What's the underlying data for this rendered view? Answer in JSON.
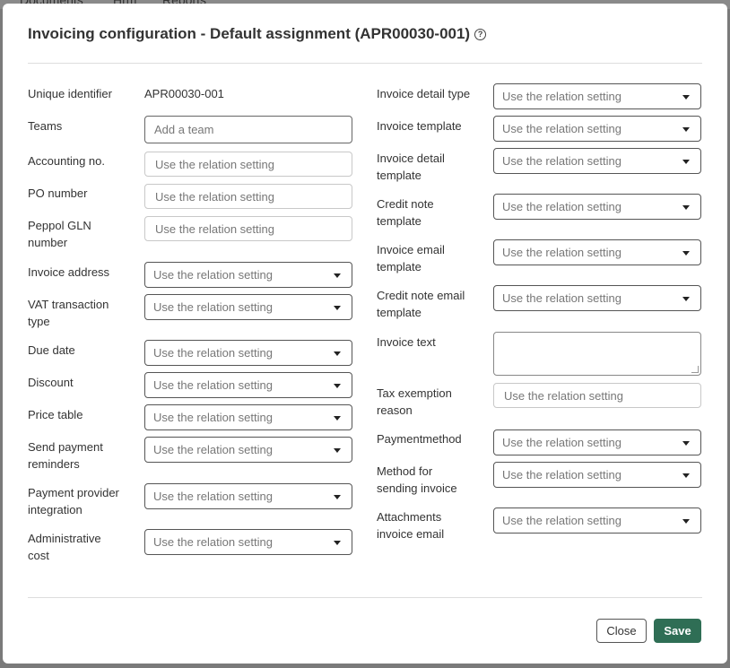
{
  "background_nav": [
    "Documents",
    "Hrm",
    "Reports"
  ],
  "dialog": {
    "title": "Invoicing configuration - Default assignment (APR00030-001)",
    "help_icon": "question-circle-icon"
  },
  "left": {
    "unique_identifier": {
      "label": "Unique identifier",
      "value": "APR00030-001"
    },
    "teams": {
      "label": "Teams",
      "placeholder": "Add a team"
    },
    "accounting_no": {
      "label": "Accounting no.",
      "placeholder": "Use the relation setting"
    },
    "po_number": {
      "label": "PO number",
      "placeholder": "Use the relation setting"
    },
    "peppol_gln": {
      "label_1": "Peppol GLN",
      "label_2": "number",
      "placeholder": "Use the relation setting"
    },
    "invoice_address": {
      "label": "Invoice address",
      "value": "Use the relation setting"
    },
    "vat_transaction_type": {
      "label_1": "VAT transaction",
      "label_2": "type",
      "value": "Use the relation setting"
    },
    "due_date": {
      "label": "Due date",
      "value": "Use the relation setting"
    },
    "discount": {
      "label": "Discount",
      "value": "Use the relation setting"
    },
    "price_table": {
      "label": "Price table",
      "value": "Use the relation setting"
    },
    "send_payment_reminders": {
      "label_1": "Send payment",
      "label_2": "reminders",
      "value": "Use the relation setting"
    },
    "payment_provider_integration": {
      "label_1": "Payment provider",
      "label_2": "integration",
      "value": "Use the relation setting"
    },
    "administrative_cost": {
      "label_1": "Administrative",
      "label_2": "cost",
      "value": "Use the relation setting"
    }
  },
  "right": {
    "invoice_detail_type": {
      "label": "Invoice detail type",
      "value": "Use the relation setting"
    },
    "invoice_template": {
      "label": "Invoice template",
      "value": "Use the relation setting"
    },
    "invoice_detail_template": {
      "label_1": "Invoice detail",
      "label_2": "template",
      "value": "Use the relation setting"
    },
    "credit_note_template": {
      "label_1": "Credit note",
      "label_2": "template",
      "value": "Use the relation setting"
    },
    "invoice_email_template": {
      "label_1": "Invoice email",
      "label_2": "template",
      "value": "Use the relation setting"
    },
    "credit_note_email_template": {
      "label_1": "Credit note email",
      "label_2": "template",
      "value": "Use the relation setting"
    },
    "invoice_text": {
      "label": "Invoice text",
      "value": ""
    },
    "tax_exemption_reason": {
      "label_1": "Tax exemption",
      "label_2": "reason",
      "placeholder": "Use the relation setting"
    },
    "paymentmethod": {
      "label": "Paymentmethod",
      "value": "Use the relation setting"
    },
    "method_for_sending_invoice": {
      "label_1": "Method for",
      "label_2": "sending invoice",
      "value": "Use the relation setting"
    },
    "attachments_invoice_email": {
      "label_1": "Attachments",
      "label_2": "invoice email",
      "value": "Use the relation setting"
    }
  },
  "footer": {
    "close_label": "Close",
    "save_label": "Save"
  },
  "colors": {
    "accent": "#2f6e55",
    "overlay": "#7a7a7a"
  }
}
